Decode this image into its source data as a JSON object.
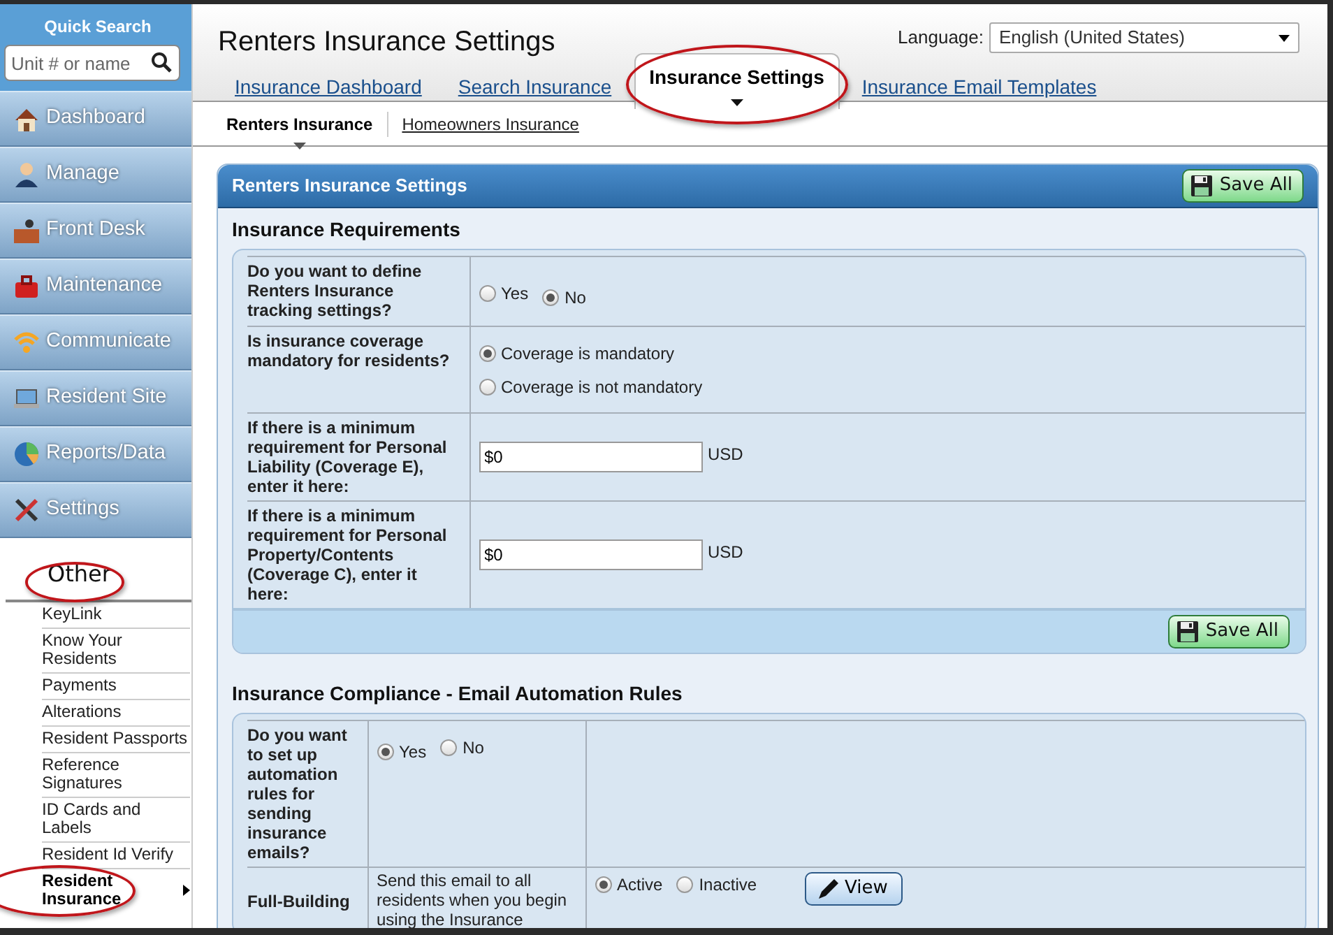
{
  "sidebar": {
    "search_title": "Quick Search",
    "search_placeholder": "Unit # or name",
    "nav": [
      {
        "label": "Dashboard"
      },
      {
        "label": "Manage"
      },
      {
        "label": "Front Desk"
      },
      {
        "label": "Maintenance"
      },
      {
        "label": "Communicate"
      },
      {
        "label": "Resident Site"
      },
      {
        "label": "Reports/Data"
      },
      {
        "label": "Settings"
      }
    ],
    "section": {
      "label": "Other",
      "highlighted": true
    },
    "items": [
      {
        "label": "KeyLink",
        "selected": false,
        "highlighted": false
      },
      {
        "label": "Know Your Residents",
        "selected": false,
        "highlighted": false
      },
      {
        "label": "Payments",
        "selected": false,
        "highlighted": false
      },
      {
        "label": "Alterations",
        "selected": false,
        "highlighted": false
      },
      {
        "label": "Resident Passports",
        "selected": false,
        "highlighted": false
      },
      {
        "label": "Reference Signatures",
        "selected": false,
        "highlighted": false
      },
      {
        "label": "ID Cards and Labels",
        "selected": false,
        "highlighted": false
      },
      {
        "label": "Resident Id Verify",
        "selected": false,
        "highlighted": false
      },
      {
        "label": "Resident Insurance",
        "selected": true,
        "highlighted": true
      }
    ]
  },
  "header": {
    "title": "Renters Insurance Settings",
    "language_label": "Language:",
    "language_value": "English (United States)"
  },
  "tabs": [
    {
      "label": "Insurance Dashboard",
      "selected": false,
      "highlighted": false
    },
    {
      "label": "Search Insurance",
      "selected": false,
      "highlighted": false
    },
    {
      "label": "Insurance Settings",
      "selected": true,
      "highlighted": true
    },
    {
      "label": "Insurance Email Templates",
      "selected": false,
      "highlighted": false
    }
  ],
  "subtabs": [
    {
      "label": "Renters Insurance",
      "selected": true
    },
    {
      "label": "Homeowners Insurance",
      "selected": false
    }
  ],
  "panel": {
    "title": "Renters Insurance Settings",
    "save_button": "Save All",
    "sections": [
      {
        "title": "Insurance Requirements",
        "footer_button": "Save All",
        "rows": [
          {
            "kind": "radio",
            "question": "Do you want to define Renters Insurance tracking settings?",
            "options": [
              {
                "label": "Yes",
                "selected": false
              },
              {
                "label": "No",
                "selected": true
              }
            ]
          },
          {
            "kind": "stacked",
            "question": "Is insurance coverage mandatory for residents?",
            "options": [
              {
                "label": "Coverage is mandatory",
                "selected": true
              },
              {
                "label": "Coverage is not mandatory",
                "selected": false
              }
            ]
          },
          {
            "kind": "amount",
            "question": "If there is a minimum requirement for Personal Liability (Coverage E), enter it here:",
            "value": "$0",
            "unit": "USD"
          },
          {
            "kind": "amount",
            "question": "If there is a minimum requirement for Personal Property/Contents (Coverage C), enter it here:",
            "value": "$0",
            "unit": "USD"
          }
        ]
      },
      {
        "title": "Insurance Compliance - Email Automation Rules",
        "rows": [
          {
            "kind": "radio",
            "question": "Do you want to set up automation rules for sending insurance emails?",
            "options": [
              {
                "label": "Yes",
                "selected": true
              },
              {
                "label": "No",
                "selected": false
              }
            ]
          },
          {
            "kind": "rule",
            "name": "Full-Building",
            "description": "Send this email to all residents when you begin using the Insurance",
            "options": [
              {
                "label": "Active",
                "selected": true
              },
              {
                "label": "Inactive",
                "selected": false
              }
            ],
            "button": "View"
          }
        ]
      }
    ]
  }
}
